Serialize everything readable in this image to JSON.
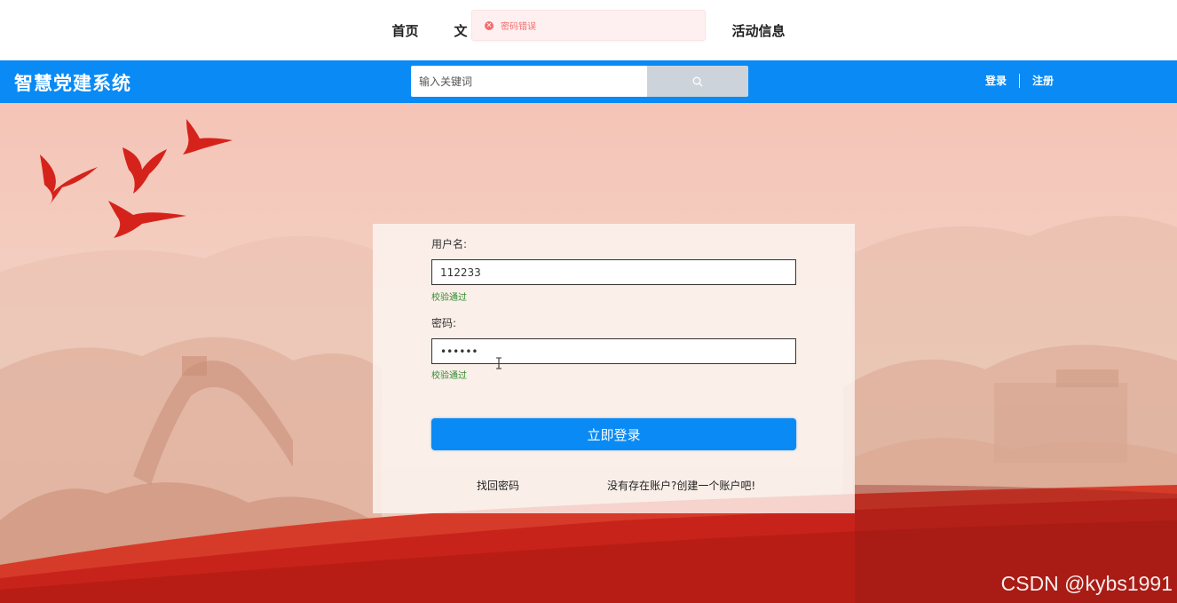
{
  "topnav": {
    "items": [
      "首页",
      "文",
      "",
      "活动信息"
    ]
  },
  "toast": {
    "message": "密码错误",
    "icon": "error-circle-icon",
    "color": "#f56c6c"
  },
  "header": {
    "logo": "智慧党建系统",
    "search_placeholder": "输入关键词",
    "search_icon": "search-icon",
    "login": "登录",
    "register": "注册",
    "bar_color": "#0a8af4"
  },
  "form": {
    "username_label": "用户名:",
    "username_value": "112233",
    "username_status": "校验通过",
    "password_label": "密码:",
    "password_value": "123456",
    "password_status": "校验通过",
    "submit": "立即登录",
    "forgot": "找回密码",
    "create": "没有存在账户?创建一个账户吧!"
  },
  "watermark": "CSDN @kybs1991"
}
